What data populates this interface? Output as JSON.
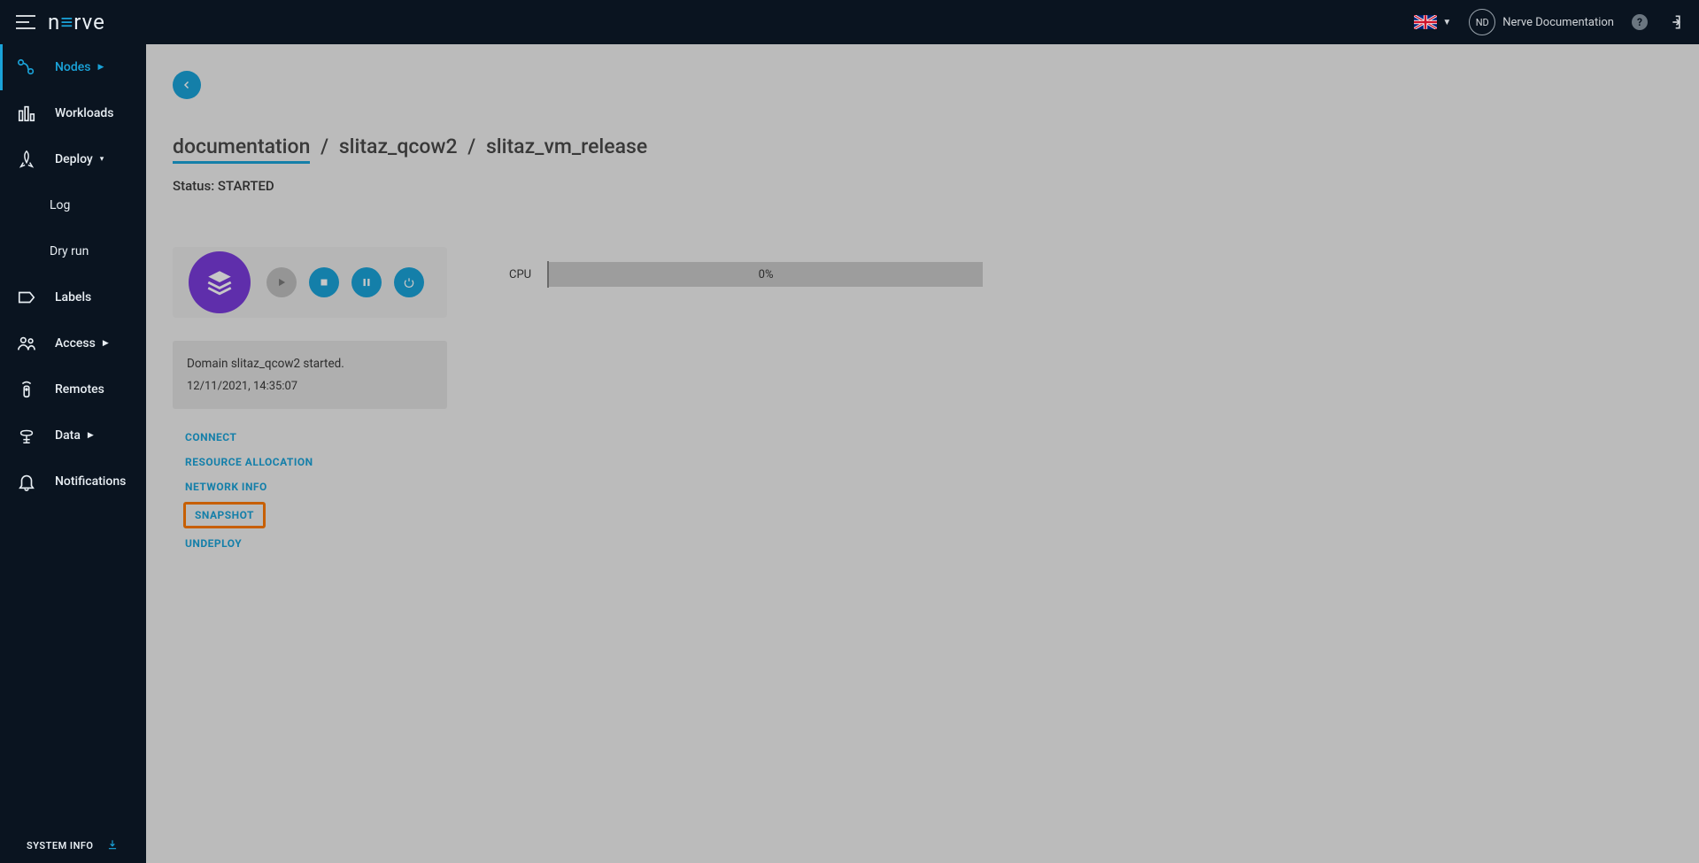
{
  "header": {
    "logo_pre": "n",
    "logo_accent": "≡",
    "logo_post": "rve",
    "avatar_initials": "ND",
    "user_name": "Nerve Documentation"
  },
  "sidebar": {
    "items": {
      "nodes": "Nodes",
      "workloads": "Workloads",
      "deploy": "Deploy",
      "log": "Log",
      "dryrun": "Dry run",
      "labels": "Labels",
      "access": "Access",
      "remotes": "Remotes",
      "data": "Data",
      "notifications": "Notifications"
    },
    "sysinfo": "SYSTEM INFO"
  },
  "breadcrumb": {
    "p0": "documentation",
    "p1": "slitaz_qcow2",
    "p2": "slitaz_vm_release"
  },
  "status_label": "Status: ",
  "status_value": "STARTED",
  "cpu": {
    "label": "CPU",
    "percent": "0%"
  },
  "event": {
    "message": "Domain slitaz_qcow2 started.",
    "timestamp": "12/11/2021, 14:35:07"
  },
  "actions": {
    "connect": "CONNECT",
    "resource": "RESOURCE ALLOCATION",
    "network": "NETWORK INFO",
    "snapshot": "SNAPSHOT",
    "undeploy": "UNDEPLOY"
  }
}
